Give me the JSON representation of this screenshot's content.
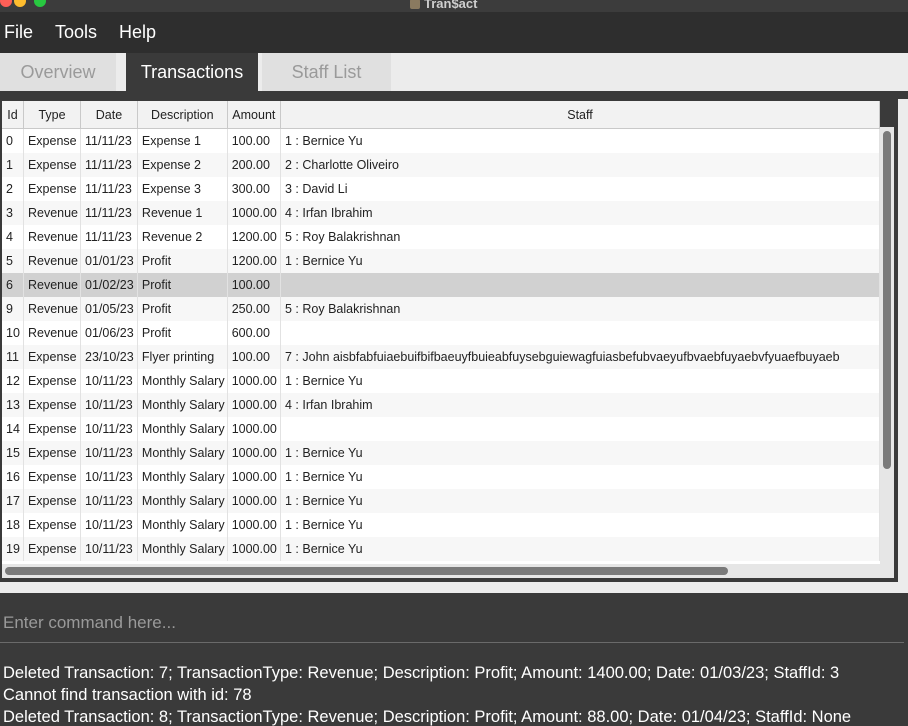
{
  "window": {
    "title": "Tran$act"
  },
  "menu": [
    "File",
    "Tools",
    "Help"
  ],
  "tabs": [
    {
      "label": "Overview",
      "active": false
    },
    {
      "label": "Transactions",
      "active": true
    },
    {
      "label": "Staff List",
      "active": false
    }
  ],
  "table": {
    "columns": [
      "Id",
      "Type",
      "Date",
      "Description",
      "Amount",
      "Staff"
    ],
    "rows": [
      [
        "0",
        "Expense",
        "11/11/23",
        "Expense 1",
        "100.00",
        "1 : Bernice Yu"
      ],
      [
        "1",
        "Expense",
        "11/11/23",
        "Expense 2",
        "200.00",
        "2 : Charlotte Oliveiro"
      ],
      [
        "2",
        "Expense",
        "11/11/23",
        "Expense 3",
        "300.00",
        "3 : David Li"
      ],
      [
        "3",
        "Revenue",
        "11/11/23",
        "Revenue 1",
        "1000.00",
        "4 : Irfan Ibrahim"
      ],
      [
        "4",
        "Revenue",
        "11/11/23",
        "Revenue 2",
        "1200.00",
        "5 : Roy Balakrishnan"
      ],
      [
        "5",
        "Revenue",
        "01/01/23",
        "Profit",
        "1200.00",
        "1 : Bernice Yu"
      ],
      [
        "6",
        "Revenue",
        "01/02/23",
        "Profit",
        "100.00",
        ""
      ],
      [
        "9",
        "Revenue",
        "01/05/23",
        "Profit",
        "250.00",
        "5 : Roy Balakrishnan"
      ],
      [
        "10",
        "Revenue",
        "01/06/23",
        "Profit",
        "600.00",
        ""
      ],
      [
        "11",
        "Expense",
        "23/10/23",
        "Flyer printing",
        "100.00",
        "7 : John aisbfabfuiaebuifbifbaeuyfbuieabfuysebguiewagfuiasbefubvaeyufbvaebfuyaebvfyuaefbuyaeb"
      ],
      [
        "12",
        "Expense",
        "10/11/23",
        "Monthly Salary",
        "1000.00",
        "1 : Bernice Yu"
      ],
      [
        "13",
        "Expense",
        "10/11/23",
        "Monthly Salary",
        "1000.00",
        "4 : Irfan Ibrahim"
      ],
      [
        "14",
        "Expense",
        "10/11/23",
        "Monthly Salary",
        "1000.00",
        ""
      ],
      [
        "15",
        "Expense",
        "10/11/23",
        "Monthly Salary",
        "1000.00",
        "1 : Bernice Yu"
      ],
      [
        "16",
        "Expense",
        "10/11/23",
        "Monthly Salary",
        "1000.00",
        "1 : Bernice Yu"
      ],
      [
        "17",
        "Expense",
        "10/11/23",
        "Monthly Salary",
        "1000.00",
        "1 : Bernice Yu"
      ],
      [
        "18",
        "Expense",
        "10/11/23",
        "Monthly Salary",
        "1000.00",
        "1 : Bernice Yu"
      ],
      [
        "19",
        "Expense",
        "10/11/23",
        "Monthly Salary",
        "1000.00",
        "1 : Bernice Yu"
      ]
    ],
    "selected_row_id": "6"
  },
  "command": {
    "placeholder": "Enter command here...",
    "value": ""
  },
  "result_lines": [
    "Deleted Transaction: 7; TransactionType: Revenue; Description: Profit; Amount: 1400.00; Date: 01/03/23; StaffId: 3",
    "Cannot find transaction with id: 78",
    "Deleted Transaction: 8; TransactionType: Revenue; Description: Profit; Amount: 88.00; Date: 01/04/23; StaffId: None"
  ],
  "colors": {
    "background": "#3a3a3a",
    "selected_row": "#d1d1d1",
    "traffic_red": "#ff5f57",
    "traffic_yellow": "#febc2e",
    "traffic_green": "#28c840"
  },
  "icons": [
    "close-window-icon",
    "minimize-window-icon",
    "zoom-window-icon",
    "app-icon"
  ]
}
